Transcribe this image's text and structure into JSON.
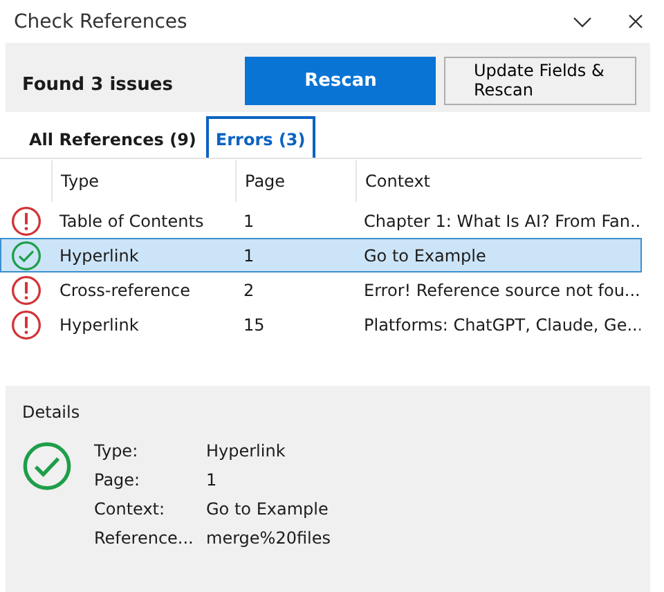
{
  "window": {
    "title": "Check References"
  },
  "summary": "Found 3 issues",
  "buttons": [
    {
      "label": "Rescan",
      "kind": "primary"
    },
    {
      "label": "Update Fields & Rescan",
      "kind": "secondary"
    }
  ],
  "tabs": [
    {
      "label": "All References (9)",
      "selected": false
    },
    {
      "label": "Errors (3)",
      "selected": true
    }
  ],
  "table": {
    "columns": [
      "Type",
      "Page",
      "Context"
    ],
    "rows": [
      {
        "kind": "error",
        "selected": false,
        "cells": [
          "Table of Contents",
          "1",
          "Chapter 1: What Is AI? From Fan..."
        ]
      },
      {
        "kind": "ok",
        "selected": true,
        "cells": [
          "Hyperlink",
          "1",
          "Go to Example"
        ]
      },
      {
        "kind": "error",
        "selected": false,
        "cells": [
          "Cross-reference",
          "2",
          "Error! Reference source not fou..."
        ]
      },
      {
        "kind": "error",
        "selected": false,
        "cells": [
          "Hyperlink",
          "15",
          "Platforms: ChatGPT, Claude, Ge..."
        ]
      }
    ]
  },
  "details": {
    "title": "Details",
    "kind": "ok",
    "fields": [
      {
        "label": "Type:",
        "value": "Hyperlink"
      },
      {
        "label": "Page:",
        "value": "1"
      },
      {
        "label": "Context:",
        "value": "Go to Example"
      },
      {
        "label": "Reference...",
        "value": "merge%20files"
      }
    ]
  }
}
